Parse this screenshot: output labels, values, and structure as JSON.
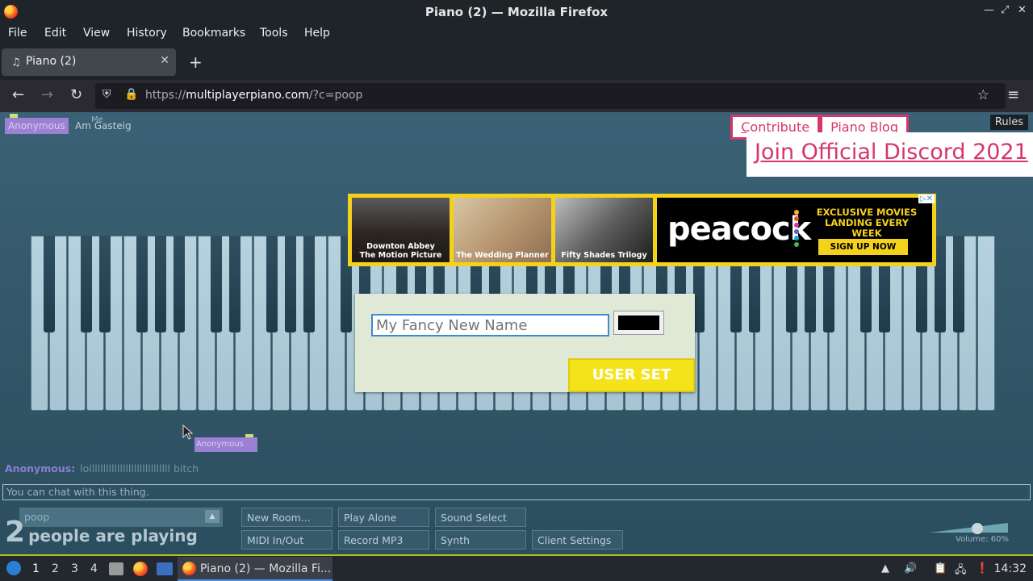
{
  "window": {
    "title": "Piano (2) — Mozilla Firefox"
  },
  "menu": [
    "File",
    "Edit",
    "View",
    "History",
    "Bookmarks",
    "Tools",
    "Help"
  ],
  "tab": {
    "title": "Piano (2)"
  },
  "url": {
    "prefix": "https://",
    "host": "multiplayerpiano.com",
    "path": "/?c=poop"
  },
  "page": {
    "users": {
      "user1": "Anonymous",
      "user2": "Am Gasteig",
      "me_label": "Me",
      "cursor_user": "Anonymous"
    },
    "links": {
      "contribute": "Contribute",
      "blog": "Piano Blog",
      "discord": "Join Official Discord 2021",
      "rules": "Rules"
    },
    "ad": {
      "tile1_line1": "Downton Abbey",
      "tile1_line2": "The Motion Picture",
      "tile2": "The Wedding Planner",
      "tile3": "Fifty Shades Trilogy",
      "brand": "peacock",
      "headline_line1": "EXCLUSIVE MOVIES",
      "headline_line2": "LANDING EVERY WEEK",
      "cta": "SIGN UP NOW"
    },
    "dialog": {
      "placeholder": "My Fancy New Name",
      "submit": "USER SET",
      "color": "#000000"
    },
    "chat": {
      "nick": "Anonymous:",
      "message": "lolllllllllllllllllllllllllllll bitch",
      "input_placeholder": "You can chat with this thing."
    },
    "room": {
      "name": "poop",
      "arrow": "▲"
    },
    "players": {
      "count": "2",
      "label": "people are playing"
    },
    "buttons": [
      "New Room...",
      "Play Alone",
      "Sound Select",
      "MIDI In/Out",
      "Record MP3",
      "Synth",
      "Client Settings"
    ],
    "volume": {
      "label": "Volume: 60%",
      "level": 0.6
    }
  },
  "taskbar": {
    "workspaces": [
      "1",
      "2",
      "3",
      "4"
    ],
    "active_task": "Piano (2) — Mozilla Fi...",
    "clock": "14:32"
  }
}
